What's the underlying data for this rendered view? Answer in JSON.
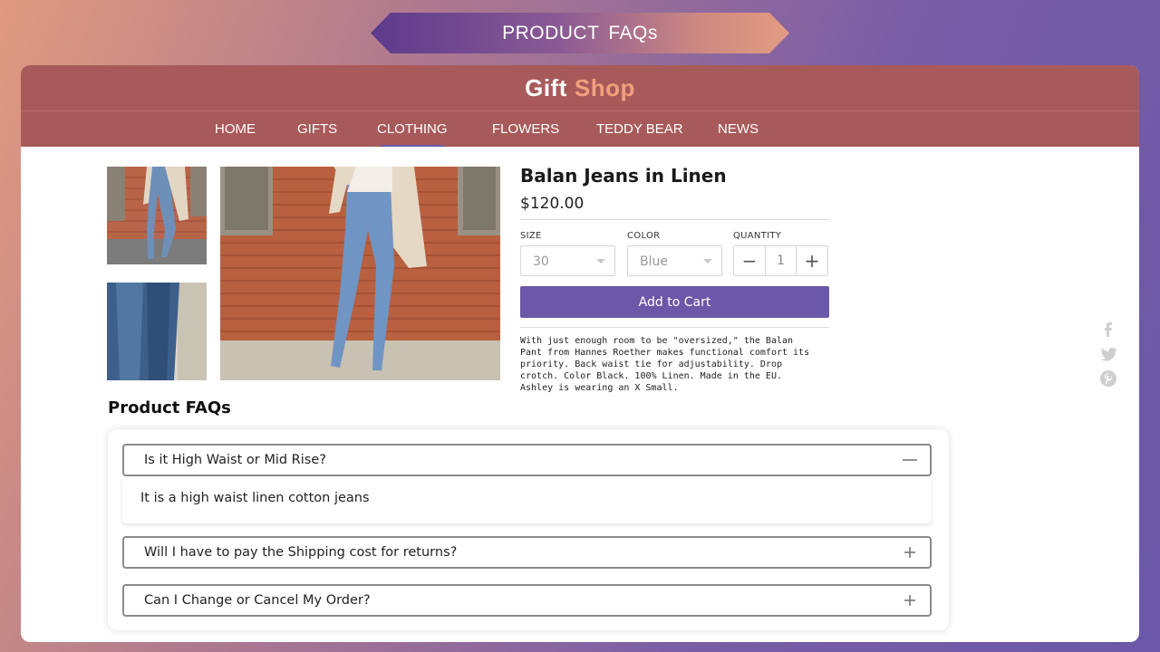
{
  "banner": {
    "title": "PRODUCT  FAQs"
  },
  "brand": {
    "word1": "Gift",
    "word2": "Shop",
    "accent_color": "#f0a07e"
  },
  "nav": {
    "items": [
      {
        "label": "HOME",
        "active": false
      },
      {
        "label": "GIFTS",
        "active": false
      },
      {
        "label": "CLOTHING",
        "active": true
      },
      {
        "label": "FLOWERS",
        "active": false
      },
      {
        "label": "TEDDY BEAR",
        "active": false
      },
      {
        "label": "NEWS",
        "active": false
      }
    ]
  },
  "product": {
    "title": "Balan Jeans in Linen",
    "price": "$120.00",
    "size": {
      "label": "SIZE",
      "value": "30"
    },
    "color": {
      "label": "COLOR",
      "value": "Blue"
    },
    "quantity": {
      "label": "QUANTITY",
      "value": "1",
      "minus": "−",
      "plus": "+"
    },
    "add_to_cart": "Add to Cart",
    "description": "With just enough room to be \"oversized,\" the Balan Pant from Hannes Roether makes functional comfort its priority. Back waist tie for adjustability. Drop crotch. Color Black. 100% Linen. Made in the EU. Ashley is wearing an X Small."
  },
  "social": [
    "facebook-icon",
    "twitter-icon",
    "pinterest-icon"
  ],
  "faq": {
    "heading": "Product FAQs",
    "items": [
      {
        "question": "Is it High Waist or Mid Rise?",
        "answer": "It is a high waist linen cotton jeans",
        "expanded": true
      },
      {
        "question": "Will I have to pay the Shipping cost for returns?",
        "expanded": false
      },
      {
        "question": "Can I Change or Cancel My Order?",
        "expanded": false
      }
    ]
  },
  "colors": {
    "header": "#a85a5a",
    "accent": "#6b58a8"
  }
}
